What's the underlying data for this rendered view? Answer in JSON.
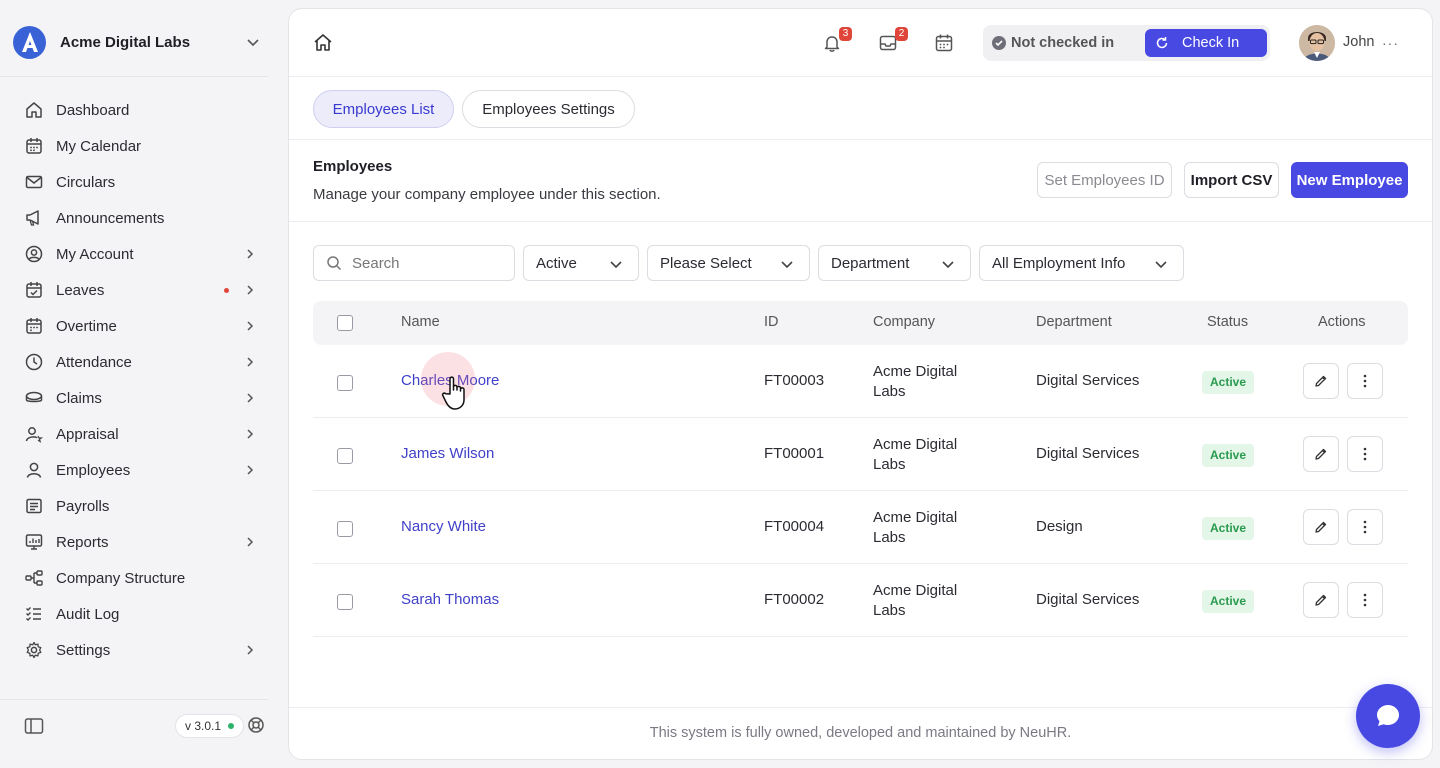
{
  "org": {
    "name": "Acme Digital Labs"
  },
  "sidebar": {
    "items": [
      {
        "label": "Dashboard",
        "icon": "home-icon",
        "chevron": false
      },
      {
        "label": "My Calendar",
        "icon": "calendar-icon",
        "chevron": false
      },
      {
        "label": "Circulars",
        "icon": "mail-icon",
        "chevron": false
      },
      {
        "label": "Announcements",
        "icon": "megaphone-icon",
        "chevron": false
      },
      {
        "label": "My Account",
        "icon": "user-circle-icon",
        "chevron": true
      },
      {
        "label": "Leaves",
        "icon": "calendar-check-icon",
        "chevron": true,
        "dot": true
      },
      {
        "label": "Overtime",
        "icon": "calendar-clock-icon",
        "chevron": true
      },
      {
        "label": "Attendance",
        "icon": "clock-icon",
        "chevron": true
      },
      {
        "label": "Claims",
        "icon": "coins-icon",
        "chevron": true
      },
      {
        "label": "Appraisal",
        "icon": "user-star-icon",
        "chevron": true
      },
      {
        "label": "Employees",
        "icon": "user-icon",
        "chevron": true
      },
      {
        "label": "Payrolls",
        "icon": "receipt-icon",
        "chevron": false
      },
      {
        "label": "Reports",
        "icon": "chart-icon",
        "chevron": true
      },
      {
        "label": "Company Structure",
        "icon": "hierarchy-icon",
        "chevron": false
      },
      {
        "label": "Audit Log",
        "icon": "checklist-icon",
        "chevron": false
      },
      {
        "label": "Settings",
        "icon": "gear-icon",
        "chevron": true
      }
    ],
    "version": "v 3.0.1"
  },
  "topbar": {
    "notifications_count": "3",
    "messages_count": "2",
    "checkin_status": "Not checked in",
    "checkin_button": "Check In",
    "user_name": "John",
    "more": "···"
  },
  "tabs": [
    {
      "label": "Employees List",
      "active": true
    },
    {
      "label": "Employees Settings",
      "active": false
    }
  ],
  "section": {
    "title": "Employees",
    "description": "Manage your company employee under this section.",
    "set_id_button": "Set Employees ID",
    "import_button": "Import CSV",
    "new_button": "New Employee"
  },
  "filters": {
    "search_placeholder": "Search",
    "status": "Active",
    "select": "Please Select",
    "department": "Department",
    "employment": "All Employment Info"
  },
  "table": {
    "headers": [
      "Name",
      "ID",
      "Company",
      "Department",
      "Status",
      "Actions"
    ],
    "rows": [
      {
        "name": "Charles Moore",
        "id": "FT00003",
        "company_line1": "Acme Digital",
        "company_line2": "Labs",
        "department": "Digital Services",
        "status": "Active"
      },
      {
        "name": "James Wilson",
        "id": "FT00001",
        "company_line1": "Acme Digital",
        "company_line2": "Labs",
        "department": "Digital Services",
        "status": "Active"
      },
      {
        "name": "Nancy White",
        "id": "FT00004",
        "company_line1": "Acme Digital",
        "company_line2": "Labs",
        "department": "Design",
        "status": "Active"
      },
      {
        "name": "Sarah Thomas",
        "id": "FT00002",
        "company_line1": "Acme Digital",
        "company_line2": "Labs",
        "department": "Digital Services",
        "status": "Active"
      }
    ]
  },
  "footer": {
    "text": "This system is fully owned, developed and maintained by NeuHR."
  },
  "colors": {
    "accent": "#4848e3",
    "status_green": "#2a9a4f",
    "badge_red": "#e0453a"
  }
}
